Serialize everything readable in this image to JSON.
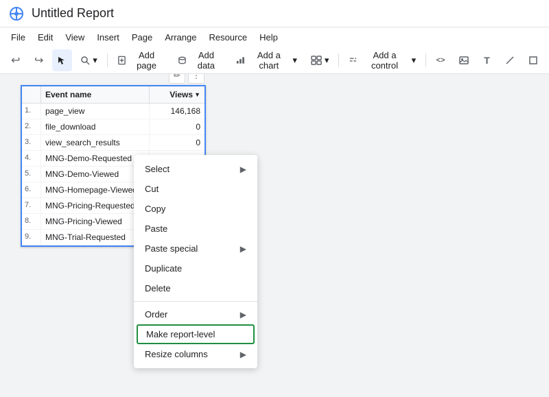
{
  "app": {
    "title": "Untitled Report",
    "icon_color": "#4285f4"
  },
  "menubar": {
    "items": [
      "File",
      "Edit",
      "View",
      "Insert",
      "Page",
      "Arrange",
      "Resource",
      "Help"
    ]
  },
  "toolbar": {
    "undo_label": "↩",
    "redo_label": "↪",
    "cursor_label": "↖",
    "zoom_label": "🔍",
    "add_page_label": "Add page",
    "add_data_label": "Add data",
    "add_chart_label": "Add a chart",
    "component_label": "⊞",
    "add_control_label": "Add a control",
    "code_label": "<>",
    "image_label": "🖼",
    "text_label": "T",
    "line_label": "╱",
    "rect_label": "□"
  },
  "table": {
    "widget_edit_title": "✏",
    "widget_more_title": "⋮",
    "header": {
      "num": "",
      "event_name": "Event name",
      "views": "Views",
      "sort_icon": "▼"
    },
    "rows": [
      {
        "num": "1.",
        "event": "page_view",
        "views": "146,168"
      },
      {
        "num": "2.",
        "event": "file_download",
        "views": "0"
      },
      {
        "num": "3.",
        "event": "view_search_results",
        "views": "0"
      },
      {
        "num": "4.",
        "event": "MNG-Demo-Requested",
        "views": ""
      },
      {
        "num": "5.",
        "event": "MNG-Demo-Viewed",
        "views": ""
      },
      {
        "num": "6.",
        "event": "MNG-Homepage-Viewed",
        "views": ""
      },
      {
        "num": "7.",
        "event": "MNG-Pricing-Requested",
        "views": ""
      },
      {
        "num": "8.",
        "event": "MNG-Pricing-Viewed",
        "views": ""
      },
      {
        "num": "9.",
        "event": "MNG-Trial-Requested",
        "views": ""
      }
    ]
  },
  "context_menu": {
    "items": [
      {
        "id": "select",
        "label": "Select",
        "has_arrow": true,
        "separator_after": false,
        "highlighted": false
      },
      {
        "id": "cut",
        "label": "Cut",
        "has_arrow": false,
        "separator_after": false,
        "highlighted": false
      },
      {
        "id": "copy",
        "label": "Copy",
        "has_arrow": false,
        "separator_after": false,
        "highlighted": false
      },
      {
        "id": "paste",
        "label": "Paste",
        "has_arrow": false,
        "separator_after": false,
        "highlighted": false
      },
      {
        "id": "paste_special",
        "label": "Paste special",
        "has_arrow": true,
        "separator_after": false,
        "highlighted": false
      },
      {
        "id": "duplicate",
        "label": "Duplicate",
        "has_arrow": false,
        "separator_after": false,
        "highlighted": false
      },
      {
        "id": "delete",
        "label": "Delete",
        "has_arrow": false,
        "separator_after": true,
        "highlighted": false
      },
      {
        "id": "order",
        "label": "Order",
        "has_arrow": true,
        "separator_after": false,
        "highlighted": false
      },
      {
        "id": "make_report_level",
        "label": "Make report-level",
        "has_arrow": false,
        "separator_after": false,
        "highlighted": true
      },
      {
        "id": "resize_columns",
        "label": "Resize columns",
        "has_arrow": true,
        "separator_after": false,
        "highlighted": false
      }
    ]
  }
}
